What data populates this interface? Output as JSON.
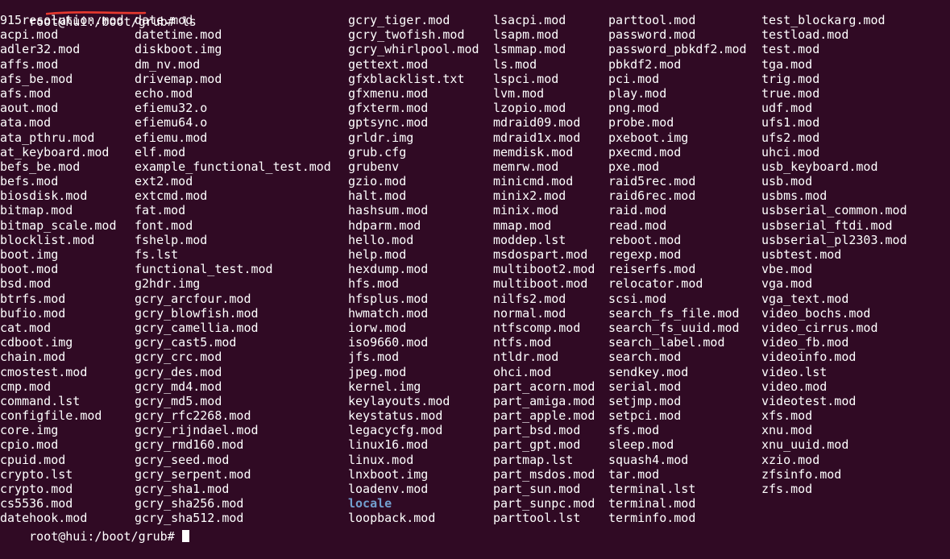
{
  "terminal": {
    "background_color": "#300a24",
    "foreground_color": "#ffffff",
    "directory_color": "#729fcf",
    "annotation_color": "#e8392f",
    "prompt_top": "root@hui:/boot/grub# ls",
    "prompt_bottom": "root@hui:/boot/grub#",
    "command": "ls",
    "user": "root",
    "host": "hui",
    "cwd": "/boot/grub",
    "cursor": "block-cursor"
  },
  "annotation": {
    "name": "red-underline",
    "target_text": "/boot/grub#",
    "color": "#e8392f"
  },
  "listing": {
    "columns": [
      {
        "index": 0,
        "entries": [
          {
            "name": "915resolution.mod",
            "type": "file"
          },
          {
            "name": "acpi.mod",
            "type": "file"
          },
          {
            "name": "adler32.mod",
            "type": "file"
          },
          {
            "name": "affs.mod",
            "type": "file"
          },
          {
            "name": "afs_be.mod",
            "type": "file"
          },
          {
            "name": "afs.mod",
            "type": "file"
          },
          {
            "name": "aout.mod",
            "type": "file"
          },
          {
            "name": "ata.mod",
            "type": "file"
          },
          {
            "name": "ata_pthru.mod",
            "type": "file"
          },
          {
            "name": "at_keyboard.mod",
            "type": "file"
          },
          {
            "name": "befs_be.mod",
            "type": "file"
          },
          {
            "name": "befs.mod",
            "type": "file"
          },
          {
            "name": "biosdisk.mod",
            "type": "file"
          },
          {
            "name": "bitmap.mod",
            "type": "file"
          },
          {
            "name": "bitmap_scale.mod",
            "type": "file"
          },
          {
            "name": "blocklist.mod",
            "type": "file"
          },
          {
            "name": "boot.img",
            "type": "file"
          },
          {
            "name": "boot.mod",
            "type": "file"
          },
          {
            "name": "bsd.mod",
            "type": "file"
          },
          {
            "name": "btrfs.mod",
            "type": "file"
          },
          {
            "name": "bufio.mod",
            "type": "file"
          },
          {
            "name": "cat.mod",
            "type": "file"
          },
          {
            "name": "cdboot.img",
            "type": "file"
          },
          {
            "name": "chain.mod",
            "type": "file"
          },
          {
            "name": "cmostest.mod",
            "type": "file"
          },
          {
            "name": "cmp.mod",
            "type": "file"
          },
          {
            "name": "command.lst",
            "type": "file"
          },
          {
            "name": "configfile.mod",
            "type": "file"
          },
          {
            "name": "core.img",
            "type": "file"
          },
          {
            "name": "cpio.mod",
            "type": "file"
          },
          {
            "name": "cpuid.mod",
            "type": "file"
          },
          {
            "name": "crypto.lst",
            "type": "file"
          },
          {
            "name": "crypto.mod",
            "type": "file"
          },
          {
            "name": "cs5536.mod",
            "type": "file"
          },
          {
            "name": "datehook.mod",
            "type": "file"
          }
        ]
      },
      {
        "index": 1,
        "entries": [
          {
            "name": "date.mod",
            "type": "file"
          },
          {
            "name": "datetime.mod",
            "type": "file"
          },
          {
            "name": "diskboot.img",
            "type": "file"
          },
          {
            "name": "dm_nv.mod",
            "type": "file"
          },
          {
            "name": "drivemap.mod",
            "type": "file"
          },
          {
            "name": "echo.mod",
            "type": "file"
          },
          {
            "name": "efiemu32.o",
            "type": "file"
          },
          {
            "name": "efiemu64.o",
            "type": "file"
          },
          {
            "name": "efiemu.mod",
            "type": "file"
          },
          {
            "name": "elf.mod",
            "type": "file"
          },
          {
            "name": "example_functional_test.mod",
            "type": "file"
          },
          {
            "name": "ext2.mod",
            "type": "file"
          },
          {
            "name": "extcmd.mod",
            "type": "file"
          },
          {
            "name": "fat.mod",
            "type": "file"
          },
          {
            "name": "font.mod",
            "type": "file"
          },
          {
            "name": "fshelp.mod",
            "type": "file"
          },
          {
            "name": "fs.lst",
            "type": "file"
          },
          {
            "name": "functional_test.mod",
            "type": "file"
          },
          {
            "name": "g2hdr.img",
            "type": "file"
          },
          {
            "name": "gcry_arcfour.mod",
            "type": "file"
          },
          {
            "name": "gcry_blowfish.mod",
            "type": "file"
          },
          {
            "name": "gcry_camellia.mod",
            "type": "file"
          },
          {
            "name": "gcry_cast5.mod",
            "type": "file"
          },
          {
            "name": "gcry_crc.mod",
            "type": "file"
          },
          {
            "name": "gcry_des.mod",
            "type": "file"
          },
          {
            "name": "gcry_md4.mod",
            "type": "file"
          },
          {
            "name": "gcry_md5.mod",
            "type": "file"
          },
          {
            "name": "gcry_rfc2268.mod",
            "type": "file"
          },
          {
            "name": "gcry_rijndael.mod",
            "type": "file"
          },
          {
            "name": "gcry_rmd160.mod",
            "type": "file"
          },
          {
            "name": "gcry_seed.mod",
            "type": "file"
          },
          {
            "name": "gcry_serpent.mod",
            "type": "file"
          },
          {
            "name": "gcry_sha1.mod",
            "type": "file"
          },
          {
            "name": "gcry_sha256.mod",
            "type": "file"
          },
          {
            "name": "gcry_sha512.mod",
            "type": "file"
          }
        ]
      },
      {
        "index": 2,
        "entries": [
          {
            "name": "gcry_tiger.mod",
            "type": "file"
          },
          {
            "name": "gcry_twofish.mod",
            "type": "file"
          },
          {
            "name": "gcry_whirlpool.mod",
            "type": "file"
          },
          {
            "name": "gettext.mod",
            "type": "file"
          },
          {
            "name": "gfxblacklist.txt",
            "type": "file"
          },
          {
            "name": "gfxmenu.mod",
            "type": "file"
          },
          {
            "name": "gfxterm.mod",
            "type": "file"
          },
          {
            "name": "gptsync.mod",
            "type": "file"
          },
          {
            "name": "grldr.img",
            "type": "file"
          },
          {
            "name": "grub.cfg",
            "type": "file"
          },
          {
            "name": "grubenv",
            "type": "file"
          },
          {
            "name": "gzio.mod",
            "type": "file"
          },
          {
            "name": "halt.mod",
            "type": "file"
          },
          {
            "name": "hashsum.mod",
            "type": "file"
          },
          {
            "name": "hdparm.mod",
            "type": "file"
          },
          {
            "name": "hello.mod",
            "type": "file"
          },
          {
            "name": "help.mod",
            "type": "file"
          },
          {
            "name": "hexdump.mod",
            "type": "file"
          },
          {
            "name": "hfs.mod",
            "type": "file"
          },
          {
            "name": "hfsplus.mod",
            "type": "file"
          },
          {
            "name": "hwmatch.mod",
            "type": "file"
          },
          {
            "name": "iorw.mod",
            "type": "file"
          },
          {
            "name": "iso9660.mod",
            "type": "file"
          },
          {
            "name": "jfs.mod",
            "type": "file"
          },
          {
            "name": "jpeg.mod",
            "type": "file"
          },
          {
            "name": "kernel.img",
            "type": "file"
          },
          {
            "name": "keylayouts.mod",
            "type": "file"
          },
          {
            "name": "keystatus.mod",
            "type": "file"
          },
          {
            "name": "legacycfg.mod",
            "type": "file"
          },
          {
            "name": "linux16.mod",
            "type": "file"
          },
          {
            "name": "linux.mod",
            "type": "file"
          },
          {
            "name": "lnxboot.img",
            "type": "file"
          },
          {
            "name": "loadenv.mod",
            "type": "file"
          },
          {
            "name": "locale",
            "type": "dir"
          },
          {
            "name": "loopback.mod",
            "type": "file"
          }
        ]
      },
      {
        "index": 3,
        "entries": [
          {
            "name": "lsacpi.mod",
            "type": "file"
          },
          {
            "name": "lsapm.mod",
            "type": "file"
          },
          {
            "name": "lsmmap.mod",
            "type": "file"
          },
          {
            "name": "ls.mod",
            "type": "file"
          },
          {
            "name": "lspci.mod",
            "type": "file"
          },
          {
            "name": "lvm.mod",
            "type": "file"
          },
          {
            "name": "lzopio.mod",
            "type": "file"
          },
          {
            "name": "mdraid09.mod",
            "type": "file"
          },
          {
            "name": "mdraid1x.mod",
            "type": "file"
          },
          {
            "name": "memdisk.mod",
            "type": "file"
          },
          {
            "name": "memrw.mod",
            "type": "file"
          },
          {
            "name": "minicmd.mod",
            "type": "file"
          },
          {
            "name": "minix2.mod",
            "type": "file"
          },
          {
            "name": "minix.mod",
            "type": "file"
          },
          {
            "name": "mmap.mod",
            "type": "file"
          },
          {
            "name": "moddep.lst",
            "type": "file"
          },
          {
            "name": "msdospart.mod",
            "type": "file"
          },
          {
            "name": "multiboot2.mod",
            "type": "file"
          },
          {
            "name": "multiboot.mod",
            "type": "file"
          },
          {
            "name": "nilfs2.mod",
            "type": "file"
          },
          {
            "name": "normal.mod",
            "type": "file"
          },
          {
            "name": "ntfscomp.mod",
            "type": "file"
          },
          {
            "name": "ntfs.mod",
            "type": "file"
          },
          {
            "name": "ntldr.mod",
            "type": "file"
          },
          {
            "name": "ohci.mod",
            "type": "file"
          },
          {
            "name": "part_acorn.mod",
            "type": "file"
          },
          {
            "name": "part_amiga.mod",
            "type": "file"
          },
          {
            "name": "part_apple.mod",
            "type": "file"
          },
          {
            "name": "part_bsd.mod",
            "type": "file"
          },
          {
            "name": "part_gpt.mod",
            "type": "file"
          },
          {
            "name": "partmap.lst",
            "type": "file"
          },
          {
            "name": "part_msdos.mod",
            "type": "file"
          },
          {
            "name": "part_sun.mod",
            "type": "file"
          },
          {
            "name": "part_sunpc.mod",
            "type": "file"
          },
          {
            "name": "parttool.lst",
            "type": "file"
          }
        ]
      },
      {
        "index": 4,
        "entries": [
          {
            "name": "parttool.mod",
            "type": "file"
          },
          {
            "name": "password.mod",
            "type": "file"
          },
          {
            "name": "password_pbkdf2.mod",
            "type": "file"
          },
          {
            "name": "pbkdf2.mod",
            "type": "file"
          },
          {
            "name": "pci.mod",
            "type": "file"
          },
          {
            "name": "play.mod",
            "type": "file"
          },
          {
            "name": "png.mod",
            "type": "file"
          },
          {
            "name": "probe.mod",
            "type": "file"
          },
          {
            "name": "pxeboot.img",
            "type": "file"
          },
          {
            "name": "pxecmd.mod",
            "type": "file"
          },
          {
            "name": "pxe.mod",
            "type": "file"
          },
          {
            "name": "raid5rec.mod",
            "type": "file"
          },
          {
            "name": "raid6rec.mod",
            "type": "file"
          },
          {
            "name": "raid.mod",
            "type": "file"
          },
          {
            "name": "read.mod",
            "type": "file"
          },
          {
            "name": "reboot.mod",
            "type": "file"
          },
          {
            "name": "regexp.mod",
            "type": "file"
          },
          {
            "name": "reiserfs.mod",
            "type": "file"
          },
          {
            "name": "relocator.mod",
            "type": "file"
          },
          {
            "name": "scsi.mod",
            "type": "file"
          },
          {
            "name": "search_fs_file.mod",
            "type": "file"
          },
          {
            "name": "search_fs_uuid.mod",
            "type": "file"
          },
          {
            "name": "search_label.mod",
            "type": "file"
          },
          {
            "name": "search.mod",
            "type": "file"
          },
          {
            "name": "sendkey.mod",
            "type": "file"
          },
          {
            "name": "serial.mod",
            "type": "file"
          },
          {
            "name": "setjmp.mod",
            "type": "file"
          },
          {
            "name": "setpci.mod",
            "type": "file"
          },
          {
            "name": "sfs.mod",
            "type": "file"
          },
          {
            "name": "sleep.mod",
            "type": "file"
          },
          {
            "name": "squash4.mod",
            "type": "file"
          },
          {
            "name": "tar.mod",
            "type": "file"
          },
          {
            "name": "terminal.lst",
            "type": "file"
          },
          {
            "name": "terminal.mod",
            "type": "file"
          },
          {
            "name": "terminfo.mod",
            "type": "file"
          }
        ]
      },
      {
        "index": 5,
        "entries": [
          {
            "name": "test_blockarg.mod",
            "type": "file"
          },
          {
            "name": "testload.mod",
            "type": "file"
          },
          {
            "name": "test.mod",
            "type": "file"
          },
          {
            "name": "tga.mod",
            "type": "file"
          },
          {
            "name": "trig.mod",
            "type": "file"
          },
          {
            "name": "true.mod",
            "type": "file"
          },
          {
            "name": "udf.mod",
            "type": "file"
          },
          {
            "name": "ufs1.mod",
            "type": "file"
          },
          {
            "name": "ufs2.mod",
            "type": "file"
          },
          {
            "name": "uhci.mod",
            "type": "file"
          },
          {
            "name": "usb_keyboard.mod",
            "type": "file"
          },
          {
            "name": "usb.mod",
            "type": "file"
          },
          {
            "name": "usbms.mod",
            "type": "file"
          },
          {
            "name": "usbserial_common.mod",
            "type": "file"
          },
          {
            "name": "usbserial_ftdi.mod",
            "type": "file"
          },
          {
            "name": "usbserial_pl2303.mod",
            "type": "file"
          },
          {
            "name": "usbtest.mod",
            "type": "file"
          },
          {
            "name": "vbe.mod",
            "type": "file"
          },
          {
            "name": "vga.mod",
            "type": "file"
          },
          {
            "name": "vga_text.mod",
            "type": "file"
          },
          {
            "name": "video_bochs.mod",
            "type": "file"
          },
          {
            "name": "video_cirrus.mod",
            "type": "file"
          },
          {
            "name": "video_fb.mod",
            "type": "file"
          },
          {
            "name": "videoinfo.mod",
            "type": "file"
          },
          {
            "name": "video.lst",
            "type": "file"
          },
          {
            "name": "video.mod",
            "type": "file"
          },
          {
            "name": "videotest.mod",
            "type": "file"
          },
          {
            "name": "xfs.mod",
            "type": "file"
          },
          {
            "name": "xnu.mod",
            "type": "file"
          },
          {
            "name": "xnu_uuid.mod",
            "type": "file"
          },
          {
            "name": "xzio.mod",
            "type": "file"
          },
          {
            "name": "zfsinfo.mod",
            "type": "file"
          },
          {
            "name": "zfs.mod",
            "type": "file"
          }
        ]
      }
    ]
  }
}
